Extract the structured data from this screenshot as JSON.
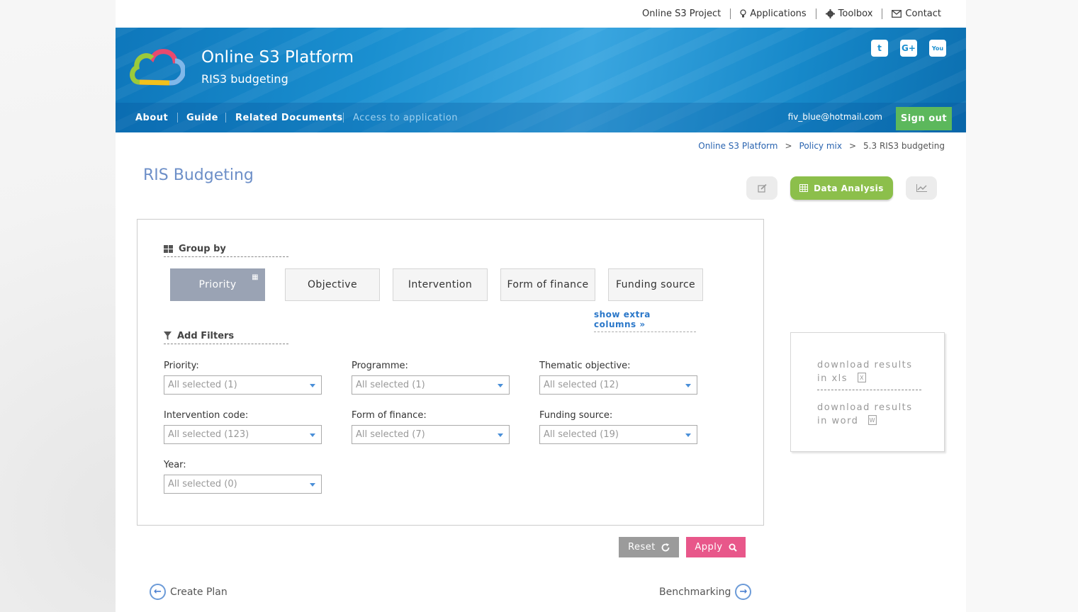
{
  "topbar": {
    "links": [
      "Online S3 Project",
      "Applications",
      "Toolbox",
      "Contact"
    ]
  },
  "header": {
    "title": "Online S3 Platform",
    "subtitle": "RIS3 budgeting",
    "social": [
      "twitter-icon",
      "google-plus-icon",
      "youtube-icon"
    ]
  },
  "nav": {
    "items": [
      "About",
      "Guide",
      "Related Documents",
      "Access to application"
    ],
    "user_email": "fiv_blue@hotmail.com",
    "sign_out": "Sign out"
  },
  "breadcrumb": [
    "Online S3 Platform",
    "Policy mix",
    "5.3 RIS3 budgeting"
  ],
  "page": {
    "title": "RIS Budgeting",
    "data_analysis": "Data Analysis"
  },
  "group_by": {
    "heading": "Group by",
    "options": [
      "Priority",
      "Objective",
      "Intervention",
      "Form of finance",
      "Funding source"
    ],
    "active": "Priority",
    "show_extra": "show extra columns »"
  },
  "filters": {
    "heading": "Add Filters",
    "items": [
      {
        "label": "Priority:",
        "value": "All selected (1)"
      },
      {
        "label": "Programme:",
        "value": "All selected (1)"
      },
      {
        "label": "Thematic objective:",
        "value": "All selected (12)"
      },
      {
        "label": "Intervention code:",
        "value": "All selected (123)"
      },
      {
        "label": "Form of finance:",
        "value": "All selected (7)"
      },
      {
        "label": "Funding source:",
        "value": "All selected (19)"
      },
      {
        "label": "Year:",
        "value": "All selected (0)"
      }
    ]
  },
  "actions": {
    "reset": "Reset",
    "apply": "Apply"
  },
  "downloads": {
    "xls_line1": "download results",
    "xls_line2": "in xls",
    "word_line1": "download results",
    "word_line2": "in word"
  },
  "footer_nav": {
    "prev": "Create Plan",
    "next": "Benchmarking"
  },
  "colors": {
    "banner": "#1a8fd0",
    "sign_out": "#5cb85c",
    "data_analysis": "#8cbf4b",
    "reset": "#9b9b9b",
    "apply": "#e8578a",
    "title": "#6d8fc8"
  }
}
